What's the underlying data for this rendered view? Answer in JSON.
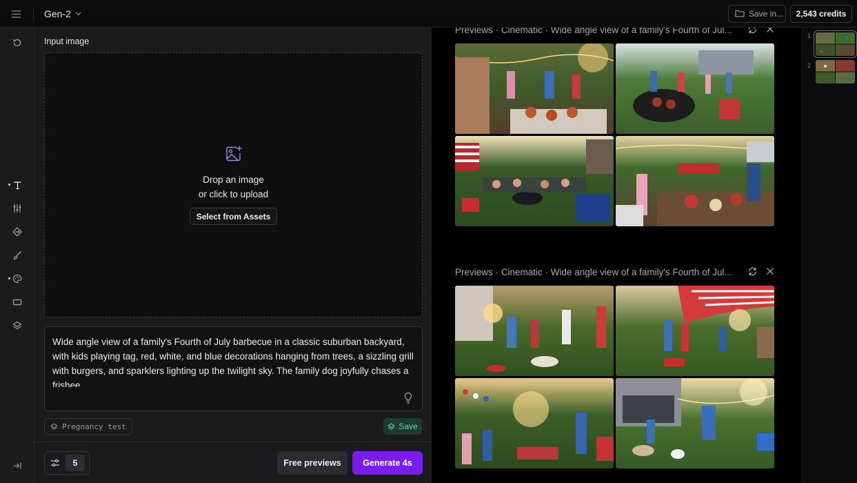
{
  "topbar": {
    "menu_icon": "hamburger-icon",
    "model_name": "Gen-2",
    "save_in_label": "Save in...",
    "credits_label": "2,543 credits"
  },
  "rail": {
    "items": [
      {
        "name": "history",
        "icon": "history-icon"
      },
      {
        "name": "text-tool",
        "icon": "text-icon",
        "dot": true
      },
      {
        "name": "adjust",
        "icon": "sliders-icon"
      },
      {
        "name": "motion",
        "icon": "camera-motion-icon"
      },
      {
        "name": "brush",
        "icon": "motion-brush-icon"
      },
      {
        "name": "style",
        "icon": "palette-icon",
        "dot": true
      },
      {
        "name": "aspect",
        "icon": "aspect-ratio-icon"
      },
      {
        "name": "presets",
        "icon": "layers-icon"
      },
      {
        "name": "collapse",
        "icon": "collapse-icon"
      }
    ]
  },
  "panel": {
    "input_label": "Input image",
    "drop_line1": "Drop an image",
    "drop_line2": "or click to upload",
    "select_assets": "Select from Assets",
    "prompt": "Wide angle view of a family's Fourth of July barbecue in a classic suburban backyard, with kids playing tag, red, white, and blue decorations hanging from trees, a sizzling grill with burgers, and sparklers lighting up the twilight sky. The family dog joyfully chases a frisbee.",
    "preset_label": "Pregnancy test",
    "save_label": "Save",
    "count_value": "5",
    "free_previews": "Free previews",
    "generate": "Generate 4s"
  },
  "previews": [
    {
      "header": "Previews · Cinematic · Wide angle view of a family's Fourth of Jul..."
    },
    {
      "header": "Previews · Cinematic · Wide angle view of a family's Fourth of Jul..."
    }
  ],
  "strip": {
    "items": [
      {
        "num": "1"
      },
      {
        "num": "2"
      }
    ]
  },
  "colors": {
    "accent": "#7a1cf0",
    "save_green": "#61d7b1",
    "upload_icon": "#a88bf0"
  }
}
